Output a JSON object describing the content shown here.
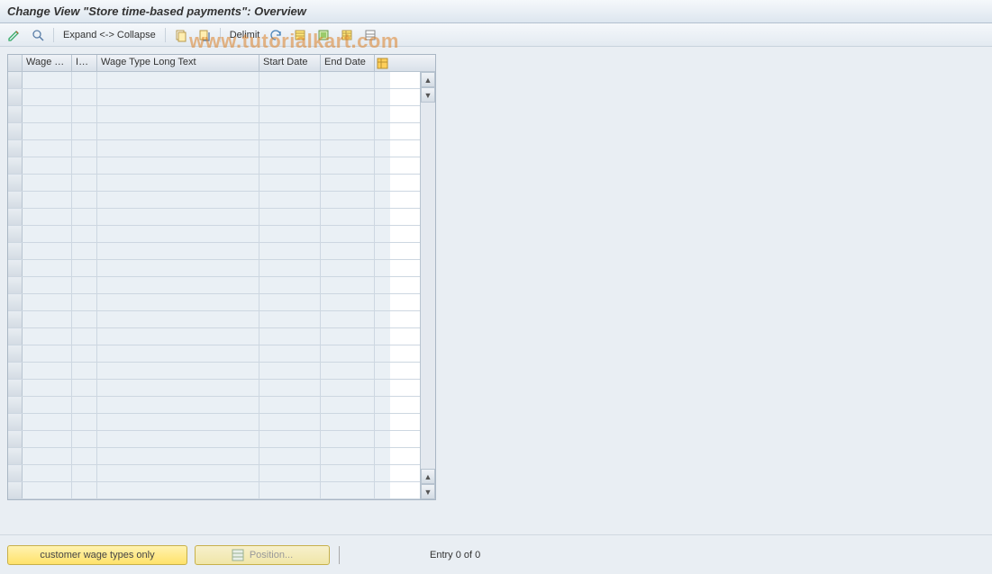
{
  "header": {
    "title": "Change View \"Store time-based payments\": Overview"
  },
  "toolbar": {
    "display_switch_icon": "display-change-icon",
    "find_icon": "find-icon",
    "expand_label": "Expand <-> Collapse",
    "copy_icon": "copy-icon",
    "paste_icon": "copy-as-icon",
    "delimit_label": "Delimit",
    "undo_icon": "undo-icon",
    "select_all_icon": "select-all-icon",
    "select_block_icon": "select-block-icon",
    "deselect_all_icon": "deselect-all-icon",
    "config_icon": "config-icon"
  },
  "table": {
    "columns": {
      "wage_type": "Wage Ty...",
      "info": "Inf...",
      "long_text": "Wage Type Long Text",
      "start_date": "Start Date",
      "end_date": "End Date"
    },
    "settings_icon": "table-settings-icon",
    "rows_visible": 25
  },
  "footer": {
    "customer_btn": "customer wage types only",
    "position_btn": "Position...",
    "entry_text": "Entry 0 of 0"
  },
  "watermark": "www.tutorialkart.com"
}
